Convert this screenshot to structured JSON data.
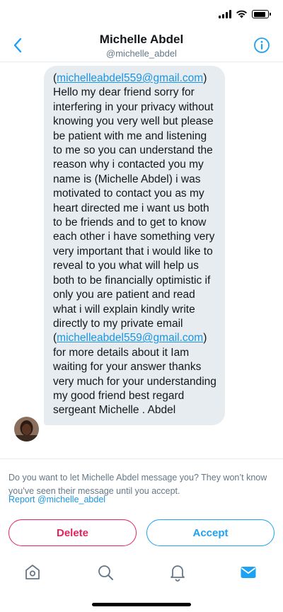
{
  "status_bar": {
    "battery_level": 0.85,
    "icons": [
      "signal-icon",
      "wifi-icon",
      "battery-icon"
    ]
  },
  "header": {
    "title": "Michelle Abdel",
    "handle": "@michelle_abdel",
    "back_icon": "chevron-left-icon",
    "info_icon": "info-icon"
  },
  "message": {
    "sender_avatar": "avatar",
    "email": "michelleabdel559@gmail.com",
    "body_part1": "Hello my dear friend sorry for interfering in your privacy without knowing you very well but please be patient with me and listening to me so you can understand the reason why i contacted you my name is (Michelle Abdel) i was motivated to contact you as my heart directed me i want us both to be friends and to get to know each other i have something very very important that i would like to reveal to you what will help us both to be financially optimistic if only you are patient and read what i will explain kindly write directly to my private email",
    "body_part2": "for more details about it Iam waiting for your answer thanks very much for your understanding my good friend best regard sergeant Michelle . Abdel"
  },
  "request": {
    "prompt": "Do you want to let Michelle Abdel message you? They won’t know you’ve seen their message until you accept.",
    "report_label": "Report @michelle_abdel",
    "delete_label": "Delete",
    "accept_label": "Accept"
  },
  "colors": {
    "accent": "#1da1f2",
    "danger": "#e0245e",
    "bubble": "#e6ecf0",
    "muted": "#657786"
  },
  "tabbar": {
    "items": [
      "home-icon",
      "search-icon",
      "notifications-icon",
      "messages-icon"
    ],
    "active": "messages-icon"
  }
}
